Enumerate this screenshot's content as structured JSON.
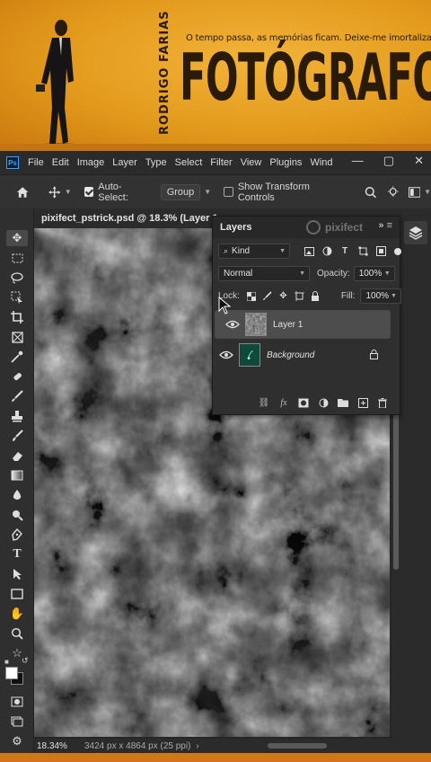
{
  "banner": {
    "name_vertical": "RODRIGO FARIAS",
    "tagline": "O tempo passa, as memórias ficam. Deixe-me imortalizar as suas.",
    "title": "FOTÓGRAFO"
  },
  "app": {
    "logo": "Ps",
    "menus": [
      "File",
      "Edit",
      "Image",
      "Layer",
      "Type",
      "Select",
      "Filter",
      "View",
      "Plugins",
      "Wind"
    ],
    "window_controls": [
      "minimize-icon",
      "restore-icon",
      "close-icon"
    ]
  },
  "options_bar": {
    "auto_select_label": "Auto-Select:",
    "auto_select_checked": true,
    "auto_select_target": "Group",
    "show_transform_label": "Show Transform Controls",
    "show_transform_checked": false,
    "icons": [
      "home-icon",
      "move-tool-icon",
      "search-icon",
      "lightbulb-icon",
      "workspace-icon"
    ]
  },
  "document": {
    "tab_title": "pixifect_pstrick.psd @ 18.3% (Layer 1,",
    "zoom": "18.34%",
    "dimensions": "3424 px x 4864 px (25 ppi)"
  },
  "layers_panel": {
    "title": "Layers",
    "watermark": "pixifect",
    "filter_kind": "Kind",
    "blend_mode": "Normal",
    "opacity_label": "Opacity:",
    "opacity_value": "100%",
    "lock_label": "Lock:",
    "fill_label": "Fill:",
    "fill_value": "100%",
    "layers": [
      {
        "name": "Layer 1",
        "selected": true,
        "visible": true
      },
      {
        "name": "Background",
        "selected": false,
        "visible": true,
        "locked": true
      }
    ],
    "footer_icons": [
      "link-icon",
      "fx-icon",
      "mask-icon",
      "adjustment-icon",
      "group-folder-icon",
      "new-layer-icon",
      "trash-icon"
    ]
  },
  "tools": [
    "move-tool-icon",
    "marquee-icon",
    "lasso-icon",
    "object-select-icon",
    "crop-icon",
    "frame-icon",
    "eyedropper-icon",
    "healing-brush-icon",
    "brush-icon",
    "clone-stamp-icon",
    "history-brush-icon",
    "eraser-icon",
    "gradient-icon",
    "blur-icon",
    "dodge-icon",
    "pen-icon",
    "type-icon",
    "path-select-icon",
    "rectangle-icon",
    "hand-icon",
    "zoom-icon",
    "star-icon"
  ],
  "colors": {
    "accent": "#31a8ff",
    "panel": "#2f2f2f",
    "banner": "#e8a12a"
  }
}
